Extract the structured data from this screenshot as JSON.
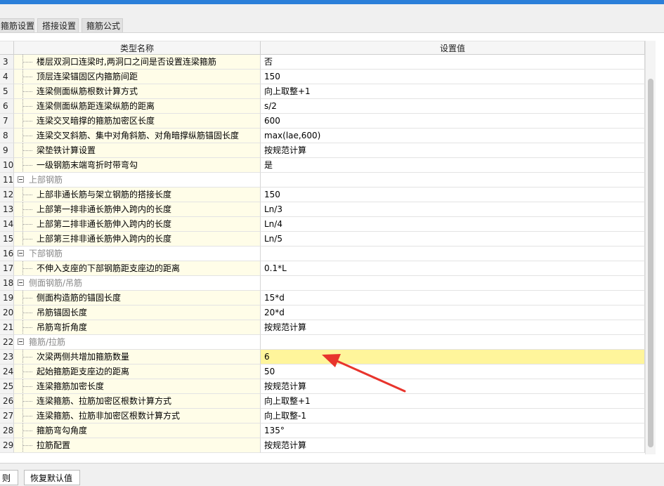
{
  "tabs": [
    "箍筋设置",
    "搭接设置",
    "箍筋公式"
  ],
  "table": {
    "headers": {
      "name": "类型名称",
      "value": "设置值"
    },
    "rows": [
      {
        "num": "3",
        "name": "楼层双洞口连梁时,两洞口之间是否设置连梁箍筋",
        "value": "否"
      },
      {
        "num": "4",
        "name": "顶层连梁锚固区内箍筋间距",
        "value": "150"
      },
      {
        "num": "5",
        "name": "连梁侧面纵筋根数计算方式",
        "value": "向上取整+1"
      },
      {
        "num": "6",
        "name": "连梁侧面纵筋距连梁纵筋的距离",
        "value": "s/2"
      },
      {
        "num": "7",
        "name": "连梁交叉暗撑的箍筋加密区长度",
        "value": "600"
      },
      {
        "num": "8",
        "name": "连梁交叉斜筋、集中对角斜筋、对角暗撑纵筋锚固长度",
        "value": "max(lae,600)"
      },
      {
        "num": "9",
        "name": "梁垫铁计算设置",
        "value": "按规范计算"
      },
      {
        "num": "10",
        "name": "一级钢筋末端弯折时带弯勾",
        "value": "是"
      },
      {
        "num": "11",
        "name": "上部钢筋",
        "value": "",
        "group": true
      },
      {
        "num": "12",
        "name": "上部非通长筋与架立钢筋的搭接长度",
        "value": "150"
      },
      {
        "num": "13",
        "name": "上部第一排非通长筋伸入跨内的长度",
        "value": "Ln/3"
      },
      {
        "num": "14",
        "name": "上部第二排非通长筋伸入跨内的长度",
        "value": "Ln/4"
      },
      {
        "num": "15",
        "name": "上部第三排非通长筋伸入跨内的长度",
        "value": "Ln/5"
      },
      {
        "num": "16",
        "name": "下部钢筋",
        "value": "",
        "group": true
      },
      {
        "num": "17",
        "name": "不伸入支座的下部钢筋距支座边的距离",
        "value": "0.1*L"
      },
      {
        "num": "18",
        "name": "侧面钢筋/吊筋",
        "value": "",
        "group": true
      },
      {
        "num": "19",
        "name": "侧面构造筋的锚固长度",
        "value": "15*d"
      },
      {
        "num": "20",
        "name": "吊筋锚固长度",
        "value": "20*d"
      },
      {
        "num": "21",
        "name": "吊筋弯折角度",
        "value": "按规范计算"
      },
      {
        "num": "22",
        "name": "箍筋/拉筋",
        "value": "",
        "group": true
      },
      {
        "num": "23",
        "name": "次梁两侧共增加箍筋数量",
        "value": "6",
        "highlight": true
      },
      {
        "num": "24",
        "name": "起始箍筋距支座边的距离",
        "value": "50"
      },
      {
        "num": "25",
        "name": "连梁箍筋加密长度",
        "value": "按规范计算"
      },
      {
        "num": "26",
        "name": "连梁箍筋、拉筋加密区根数计算方式",
        "value": "向上取整+1"
      },
      {
        "num": "27",
        "name": "连梁箍筋、拉筋非加密区根数计算方式",
        "value": "向上取整-1"
      },
      {
        "num": "28",
        "name": "箍筋弯勾角度",
        "value": "135°"
      },
      {
        "num": "29",
        "name": "拉筋配置",
        "value": "按规范计算"
      }
    ]
  },
  "bottom": {
    "rules_label": "则",
    "restore_default_label": "恢复默认值"
  },
  "colors": {
    "highlight": "#fff59b",
    "arrow": "#e8342c",
    "accent": "#2b7fd9"
  },
  "icons": {
    "group_toggle": "minus-box-icon"
  }
}
